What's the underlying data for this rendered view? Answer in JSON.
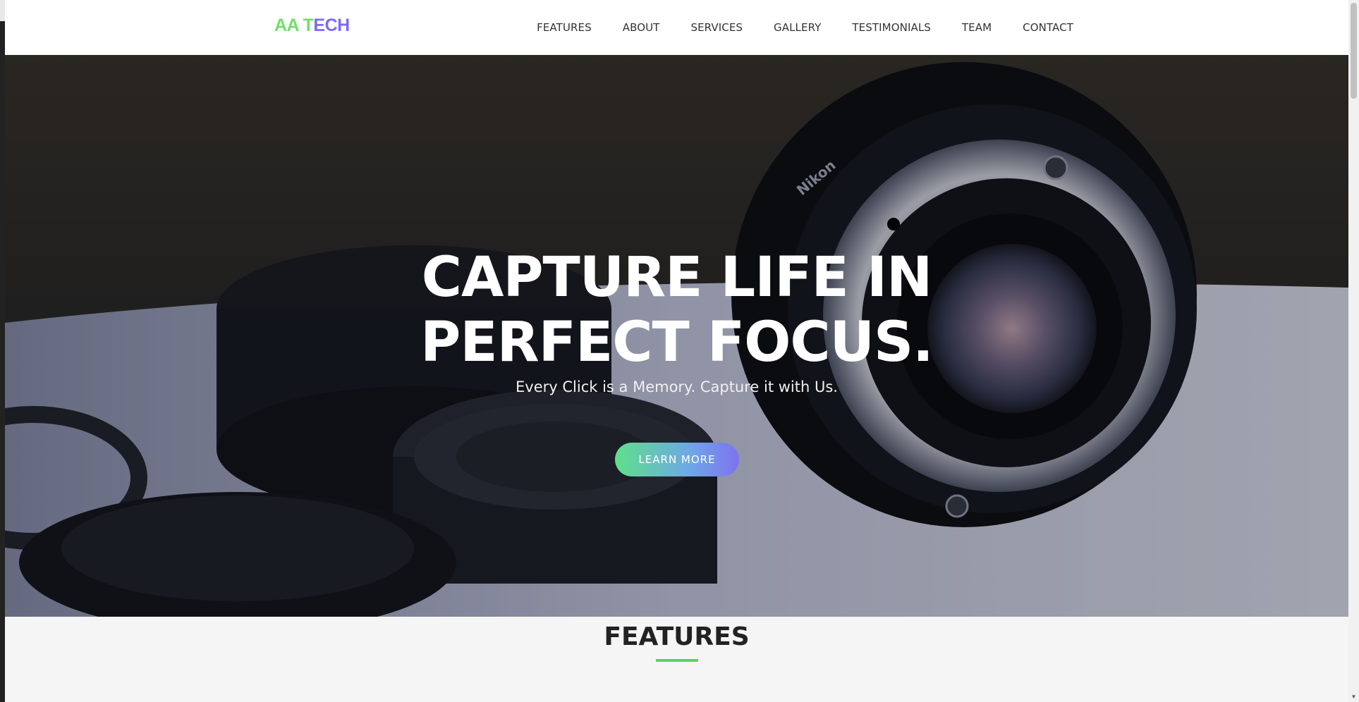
{
  "logo": {
    "part1": "AA T",
    "part2": "ECH"
  },
  "nav": {
    "items": [
      {
        "label": "FEATURES"
      },
      {
        "label": "ABOUT"
      },
      {
        "label": "SERVICES"
      },
      {
        "label": "GALLERY"
      },
      {
        "label": "TESTIMONIALS"
      },
      {
        "label": "TEAM"
      },
      {
        "label": "CONTACT"
      }
    ]
  },
  "hero": {
    "title_line1": "CAPTURE LIFE IN",
    "title_line2": "PERFECT FOCUS.",
    "subtitle": "Every Click is a Memory. Capture it with Us.",
    "button_label": "LEARN MORE",
    "image": "camera-lens-photo",
    "lens_text": "Nikon"
  },
  "features": {
    "title": "FEATURES"
  },
  "colors": {
    "brand_green": "#6ee06a",
    "brand_purple": "#7b6cf2",
    "button_gradient_start": "#5fe08a",
    "button_gradient_end": "#7e72f0",
    "underline": "#5fd06a"
  }
}
